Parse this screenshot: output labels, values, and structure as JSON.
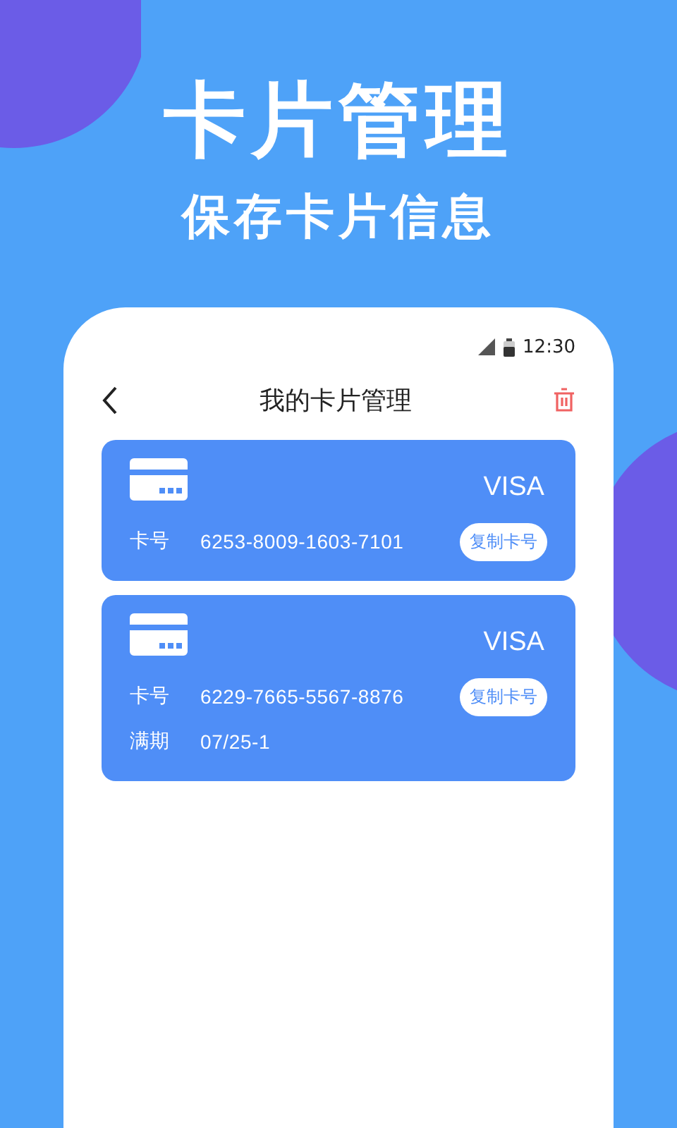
{
  "headline": "卡片管理",
  "subheadline": "保存卡片信息",
  "status_bar": {
    "time": "12:30"
  },
  "header": {
    "title": "我的卡片管理"
  },
  "cards": [
    {
      "brand": "VISA",
      "rows": [
        {
          "label": "卡号",
          "value": "6253-8009-1603-7101",
          "button": "复制卡号"
        }
      ]
    },
    {
      "brand": "VISA",
      "rows": [
        {
          "label": "卡号",
          "value": "6229-7665-5567-8876",
          "button": "复制卡号"
        },
        {
          "label": "满期",
          "value": "07/25-1"
        }
      ]
    }
  ]
}
